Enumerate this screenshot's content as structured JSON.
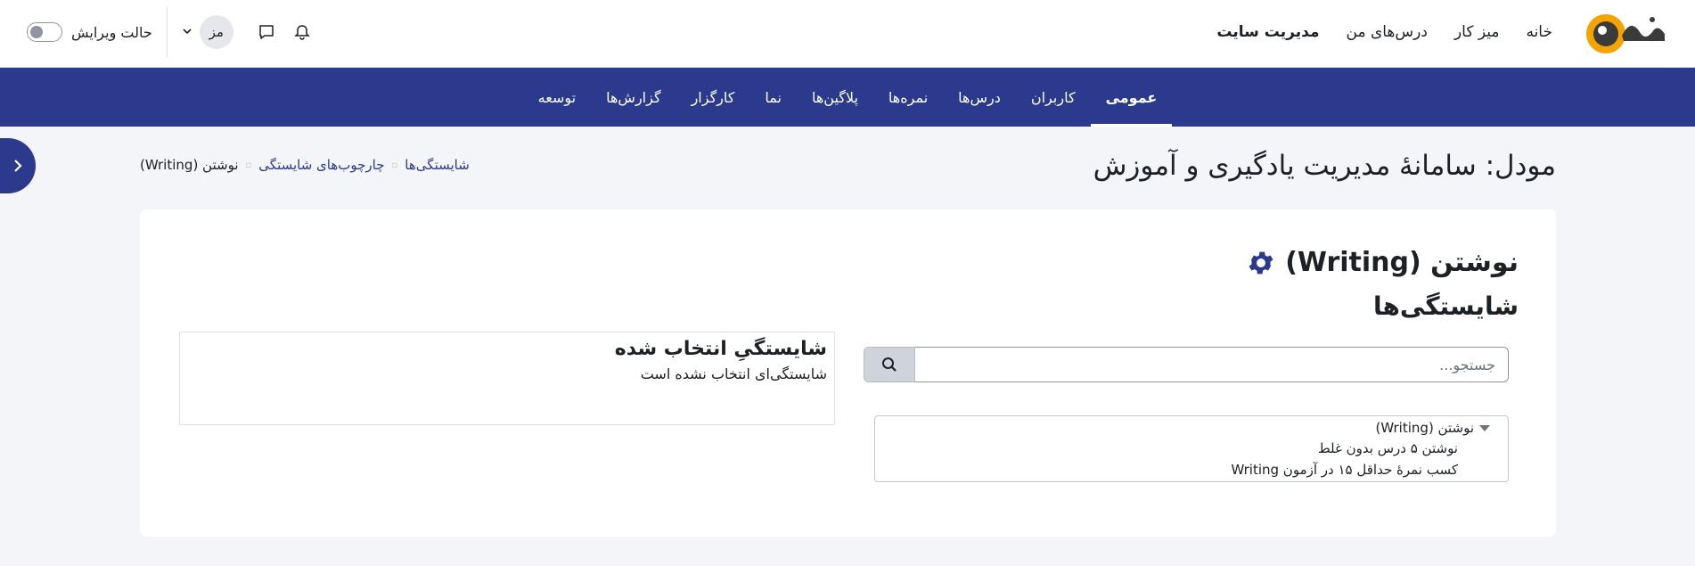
{
  "header": {
    "logo_text": "وبو",
    "nav": [
      {
        "label": "خانه"
      },
      {
        "label": "میز کار"
      },
      {
        "label": "درس‌های من"
      },
      {
        "label": "مدیریت سایت"
      }
    ],
    "edit_mode_label": "حالت ویرایش",
    "avatar_initials": "مز"
  },
  "secondary_nav": {
    "items": [
      {
        "label": "عمومی"
      },
      {
        "label": "کاربران"
      },
      {
        "label": "درس‌ها"
      },
      {
        "label": "نمره‌ها"
      },
      {
        "label": "پلاگین‌ها"
      },
      {
        "label": "نما"
      },
      {
        "label": "کارگزار"
      },
      {
        "label": "گزارش‌ها"
      },
      {
        "label": "توسعه"
      }
    ],
    "active_index": 0
  },
  "page": {
    "title": "مودل: سامانهٔ مدیریت یادگیری و آموزش",
    "breadcrumb": [
      "شایستگی‌ها",
      "چارچوب‌های شایستگی",
      "نوشتن (Writing)"
    ]
  },
  "main": {
    "framework_title": "نوشتن (Writing)",
    "section_title": "شایستگی‌ها",
    "search_placeholder": "جستجو...",
    "tree": {
      "root": "نوشتن (Writing)",
      "children": [
        "نوشتن ۵ درس بدون غلط",
        "کسب نمرهٔ حداقل ۱۵ در آزمون Writing"
      ]
    },
    "selected": {
      "heading": "شایستگیِ انتخاب شده",
      "empty_text": "شایستگی‌ای انتخاب نشده است"
    }
  },
  "colors": {
    "primary": "#2b3a8c",
    "logo_orange": "#f5a300",
    "background": "#f4f5f8"
  }
}
